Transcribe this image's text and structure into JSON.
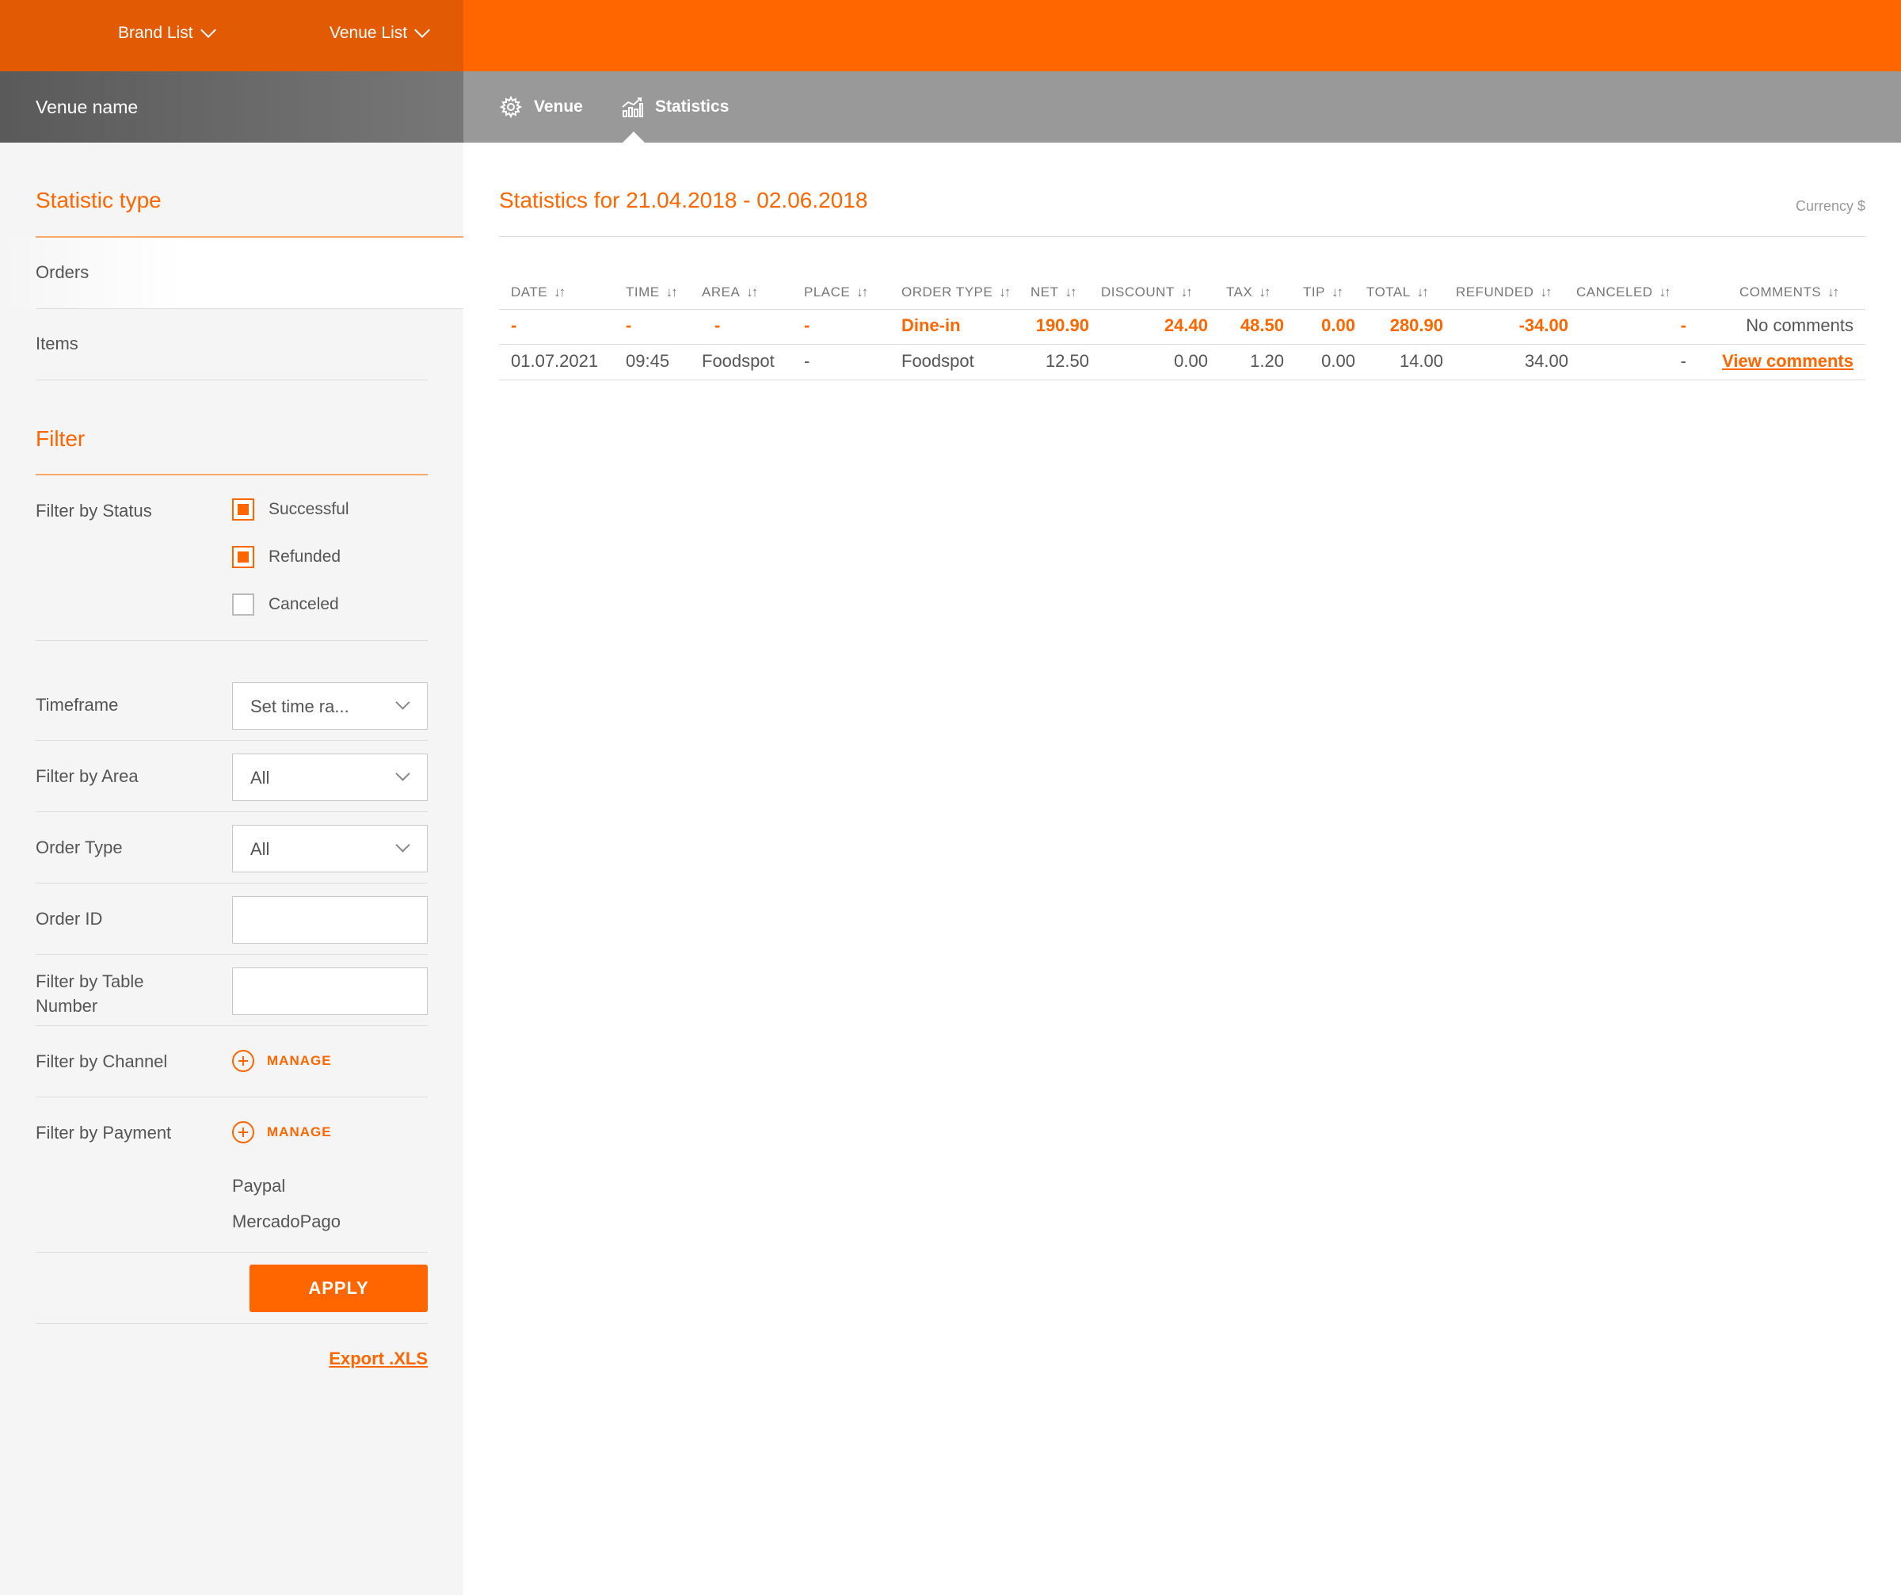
{
  "header": {
    "brand_list": "Brand List",
    "venue_list": "Venue List",
    "venue_name": "Venue name",
    "tabs": [
      {
        "label": "Venue",
        "icon": "gear-icon"
      },
      {
        "label": "Statistics",
        "icon": "chart-icon"
      }
    ],
    "accent": "#ff6600"
  },
  "sidebar": {
    "statistic_type_title": "Statistic type",
    "statistic_types": [
      "Orders",
      "Items"
    ],
    "filter_title": "Filter",
    "status": {
      "label": "Filter by Status",
      "options": [
        {
          "label": "Successful",
          "checked": true
        },
        {
          "label": "Refunded",
          "checked": true
        },
        {
          "label": "Canceled",
          "checked": false
        }
      ]
    },
    "timeframe": {
      "label": "Timeframe",
      "value": "Set time ra..."
    },
    "area": {
      "label": "Filter by Area",
      "value": "All"
    },
    "order_type": {
      "label": "Order Type",
      "value": "All"
    },
    "order_id": {
      "label": "Order ID",
      "value": ""
    },
    "table_number": {
      "label": "Filter by Table Number",
      "value": ""
    },
    "channel": {
      "label": "Filter by Channel",
      "manage": "MANAGE"
    },
    "payment": {
      "label": "Filter by Payment",
      "manage": "MANAGE",
      "items": [
        "Paypal",
        "MercadoPago"
      ]
    },
    "apply": "APPLY",
    "export": "Export .XLS"
  },
  "main": {
    "title": "Statistics for 21.04.2018 - 02.06.2018",
    "currency": "Currency $",
    "columns": [
      "DATE",
      "TIME",
      "AREA",
      "PLACE",
      "ORDER TYPE",
      "NET",
      "DISCOUNT",
      "TAX",
      "TIP",
      "TOTAL",
      "REFUNDED",
      "CANCELED",
      "COMMENTS"
    ],
    "summary_row": {
      "date": "-",
      "time": "-",
      "area": "-",
      "place": "-",
      "order_type": "Dine-in",
      "net": "190.90",
      "discount": "24.40",
      "tax": "48.50",
      "tip": "0.00",
      "total": "280.90",
      "refunded": "-34.00",
      "canceled": "-",
      "comments": "No comments"
    },
    "rows": [
      {
        "date": "01.07.2021",
        "time": "09:45",
        "area": "Foodspot",
        "place": "-",
        "order_type": "Foodspot",
        "net": "12.50",
        "discount": "0.00",
        "tax": "1.20",
        "tip": "0.00",
        "total": "14.00",
        "refunded": "34.00",
        "canceled": "-",
        "comments": "View comments"
      }
    ]
  }
}
